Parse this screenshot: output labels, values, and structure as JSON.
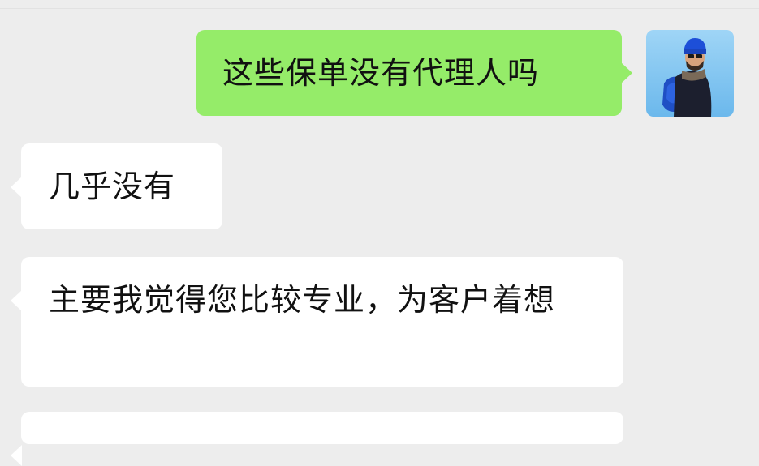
{
  "chat": {
    "messages": [
      {
        "direction": "sent",
        "text": "这些保单没有代理人吗"
      },
      {
        "direction": "received",
        "text": "几乎没有"
      },
      {
        "direction": "received",
        "text": "主要我觉得您比较专业，为客户着想"
      },
      {
        "direction": "received",
        "text": ""
      }
    ]
  },
  "avatar": {
    "icon": "user-avatar-icon"
  },
  "colors": {
    "background": "#ededed",
    "sent_bubble": "#95ec69",
    "received_bubble": "#ffffff",
    "text": "#111111"
  }
}
